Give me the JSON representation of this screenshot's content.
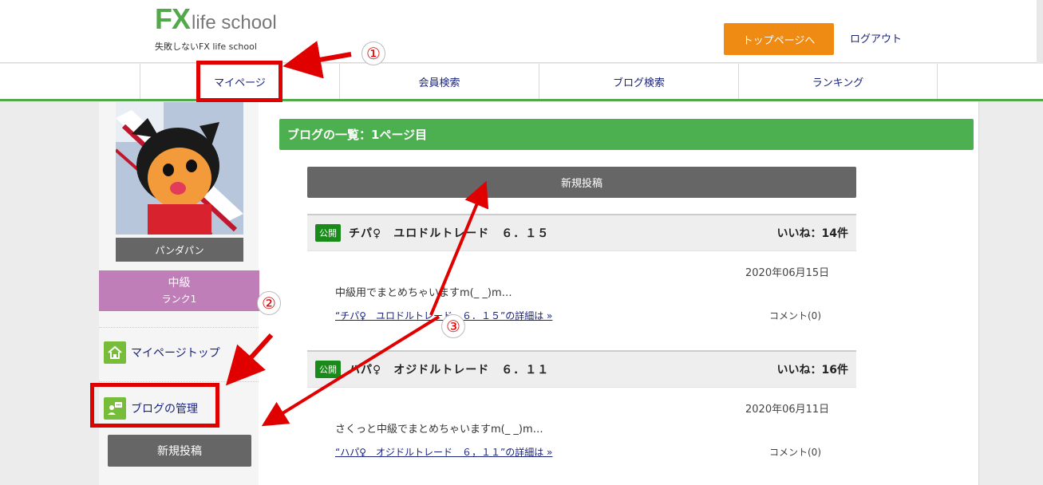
{
  "header": {
    "logo_fx": "FX",
    "logo_rest": "life school",
    "tagline": "失敗しないFX life school",
    "top_button": "トップページへ",
    "logout": "ログアウト"
  },
  "nav": {
    "items": [
      {
        "label": "マイページ"
      },
      {
        "label": "会員検索"
      },
      {
        "label": "ブログ検索"
      },
      {
        "label": "ランキング"
      }
    ]
  },
  "sidebar": {
    "username": "パンダパン",
    "level_name": "中級",
    "level_rank": "ランク1",
    "links": [
      {
        "label": "マイページトップ",
        "icon": "home-icon"
      },
      {
        "label": "ブログの管理",
        "icon": "blog-user-icon"
      }
    ],
    "new_post_button": "新規投稿"
  },
  "main": {
    "list_title": "ブログの一覧：1ページ目",
    "new_post_button": "新規投稿",
    "posts": [
      {
        "badge": "公開",
        "title": "チパ♀　ユロドルトレード　６．１５",
        "likes": "いいね：14件",
        "date": "2020年06月15日",
        "excerpt": "中級用でまとめちゃいますm(_ _)m…",
        "link": "“チパ♀　ユロドルトレード　６．１５”の詳細は »",
        "comments": "コメント(0)"
      },
      {
        "badge": "公開",
        "title": "ハパ♀　オジドルトレード　６．１１",
        "likes": "いいね：16件",
        "date": "2020年06月11日",
        "excerpt": "さくっと中級でまとめちゃいますm(_ _)m…",
        "link": "“ハパ♀　オジドルトレード　６，１１”の詳細は »",
        "comments": "コメント(0)"
      }
    ]
  },
  "annotations": {
    "n1": "①",
    "n2": "②",
    "n3": "③",
    "color": "#e00000"
  },
  "colors": {
    "brand_green": "#52a94a",
    "title_green": "#4caf50",
    "orange": "#ef8a13",
    "level_purple": "#c07eb9",
    "badge_green": "#1a8a1a"
  }
}
